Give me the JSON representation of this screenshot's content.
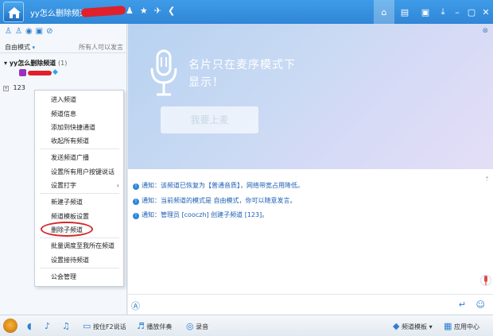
{
  "titlebar": {
    "title": "yy怎么删除频道",
    "icons": [
      "user-icon",
      "star-icon",
      "plane-icon",
      "share-icon"
    ],
    "glyphs": [
      "♟",
      "★",
      "✈",
      "❮"
    ],
    "right_icons": [
      "home-icon",
      "channel-list-icon",
      "game-icon",
      "minimize-to-tray-icon",
      "minimize-icon",
      "restore-icon",
      "close-icon"
    ],
    "right_glyphs": [
      "⌂",
      "▤",
      "▣",
      "⤓",
      "–",
      "▢",
      "✕"
    ]
  },
  "sidebar": {
    "icons": [
      "people-icon",
      "user-add-icon",
      "location-icon",
      "app-icon",
      "search-icon"
    ],
    "glyphs": [
      "♙",
      "♙",
      "◉",
      "▣",
      "⊘"
    ],
    "mode": "自由模式",
    "speak_permission": "所有人可以发言",
    "root_channel": "yy怎么删除频道",
    "root_count": "(1)",
    "sub_channel": "123",
    "expander": "+"
  },
  "context_menu": {
    "items": [
      "进入频道",
      "频道信息",
      "添加到快捷通道",
      "收起所有频道",
      "发送频道广播",
      "设置所有用户按键说话",
      "设置打字",
      "新建子频道",
      "频道模板设置",
      "删除子频道",
      "批量调度至我所在频道",
      "设置接待频道",
      "公会管理"
    ],
    "submenu_arrow": "›"
  },
  "stage": {
    "message": "名片只在麦序模式下显示！",
    "button": "我要上麦",
    "close_glyph": "⊗"
  },
  "chat": {
    "notices": [
      "通知：该频道已恢复为【普通音质】，网络带宽占用降低。",
      "通知：当前频道的模式是 自由模式，你可以随意发言。",
      "通知：管理员 [cooczh] 创建子频道 [123]。"
    ],
    "notice_glyph": "!",
    "scroll_glyph": "⇡"
  },
  "input_bar": {
    "font_glyph": "Ⓐ",
    "send_glyph": "↵",
    "emoji_glyph": "☺"
  },
  "bottombar": {
    "speaker_glyph": "◖",
    "mic_glyph": "♪",
    "eq_glyph": "♫",
    "push_to_talk": "按住F2说话",
    "play_music": "播放伴奏",
    "record": "录音",
    "channel_template": "频道模板",
    "app_center": "应用中心"
  }
}
